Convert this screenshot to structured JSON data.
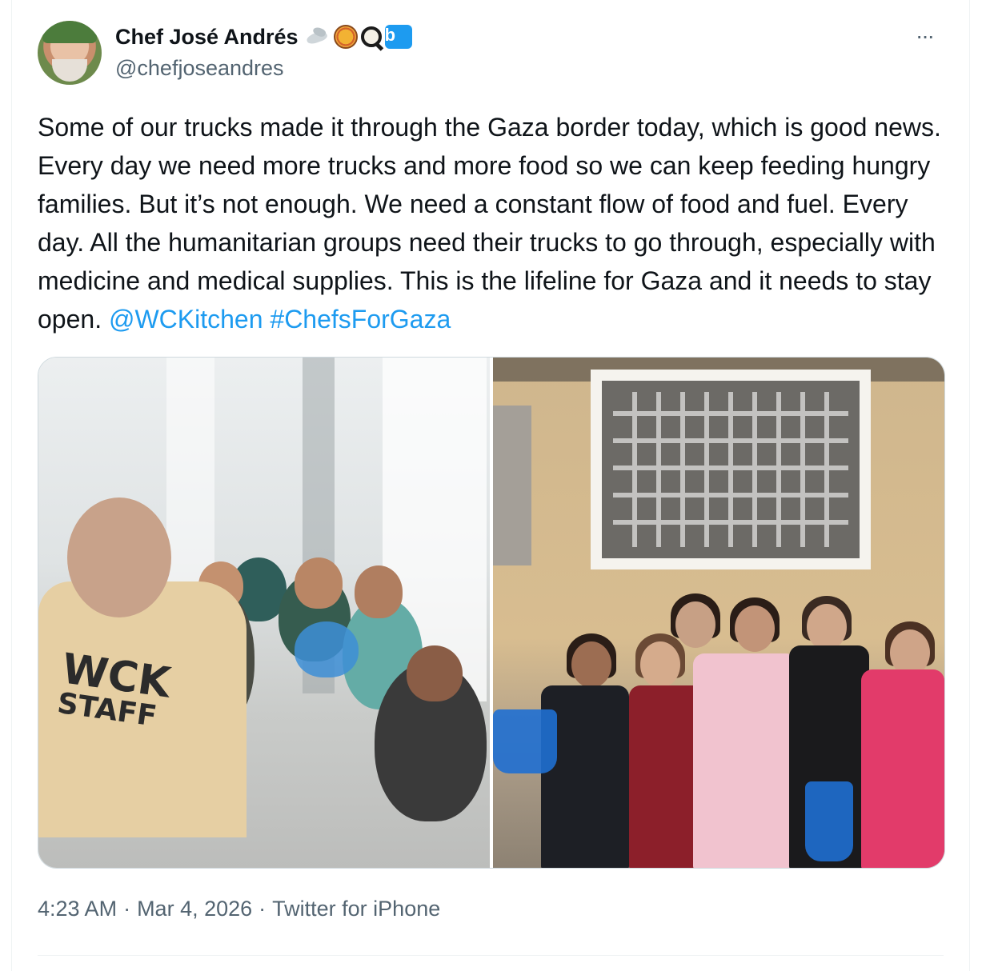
{
  "author": {
    "name": "Chef José Andrés",
    "handle": "@chefjoseandres",
    "name_emoji_icons": [
      "dove-icon",
      "pizza-icon",
      "magnifying-glass-icon",
      "bluesky-badge-icon"
    ]
  },
  "menu": {
    "more_label": "···"
  },
  "tweet": {
    "text": "Some of our trucks made it through the Gaza border today, which is good news. Every day we need more trucks and more food so we can keep feeding hungry families. But it’s not enough. We need a constant flow of food and fuel. Every day. All the humanitarian groups need their trucks to go through, especially with medicine and medical supplies. This is the lifeline for Gaza and it needs to stay open.",
    "mention": "@WCKitchen",
    "hashtag": "#ChefsForGaza"
  },
  "media": {
    "left_photo": {
      "vest_line1": "WCK",
      "vest_line2": "STAFF"
    }
  },
  "meta": {
    "time": "4:23 AM",
    "sep1": "·",
    "date": "Mar 4, 2026",
    "sep2": "·",
    "source": "Twitter for iPhone"
  },
  "colors": {
    "link": "#1d9bf0",
    "text": "#0f1419",
    "muted": "#536471",
    "border": "#cfd9de"
  }
}
